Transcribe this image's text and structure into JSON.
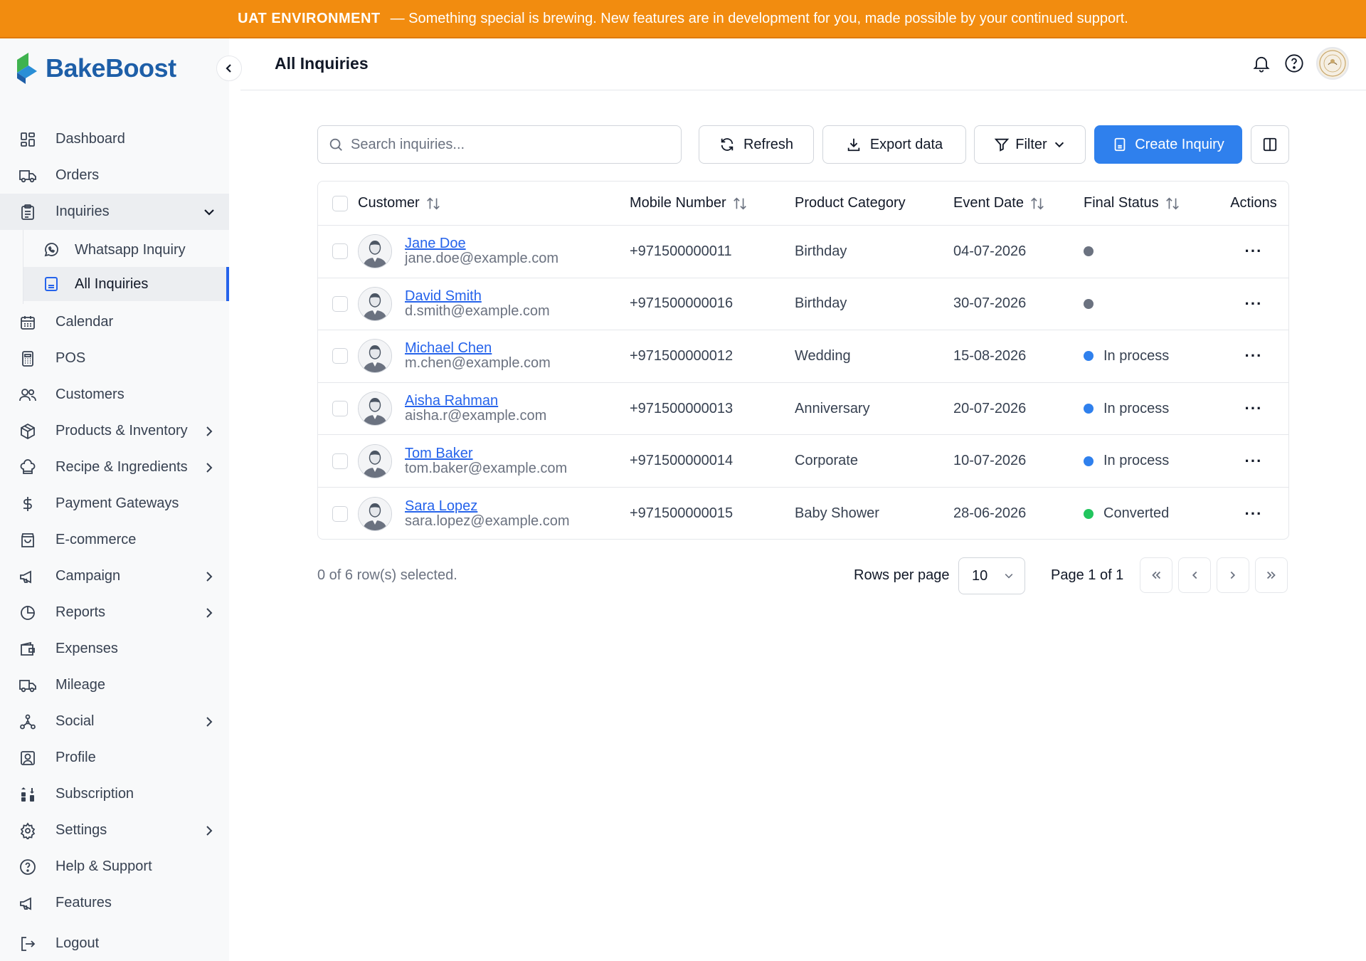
{
  "banner": {
    "env": "UAT ENVIRONMENT",
    "message": "— Something special is brewing. New features are in development for you, made possible by your continued support."
  },
  "brand": {
    "name": "BakeBoost",
    "color": "#1e5fa8"
  },
  "sidebar": {
    "items": [
      {
        "label": "Dashboard",
        "icon": "dashboard-icon"
      },
      {
        "label": "Orders",
        "icon": "truck-icon"
      },
      {
        "label": "Inquiries",
        "icon": "clipboard-icon",
        "expanded": true,
        "children": [
          {
            "label": "Whatsapp Inquiry",
            "icon": "whatsapp-icon"
          },
          {
            "label": "All Inquiries",
            "icon": "document-icon",
            "active": true
          }
        ]
      },
      {
        "label": "Calendar",
        "icon": "calendar-icon"
      },
      {
        "label": "POS",
        "icon": "calculator-icon"
      },
      {
        "label": "Customers",
        "icon": "users-icon"
      },
      {
        "label": "Products & Inventory",
        "icon": "box-icon",
        "has_children": true
      },
      {
        "label": "Recipe & Ingredients",
        "icon": "chef-hat-icon",
        "has_children": true
      },
      {
        "label": "Payment Gateways",
        "icon": "dollar-icon"
      },
      {
        "label": "E-commerce",
        "icon": "shopping-bag-icon"
      },
      {
        "label": "Campaign",
        "icon": "megaphone-icon",
        "has_children": true
      },
      {
        "label": "Reports",
        "icon": "pie-chart-icon",
        "has_children": true
      },
      {
        "label": "Expenses",
        "icon": "wallet-icon"
      },
      {
        "label": "Mileage",
        "icon": "truck-icon"
      },
      {
        "label": "Social",
        "icon": "share-icon",
        "has_children": true
      },
      {
        "label": "Profile",
        "icon": "profile-icon"
      },
      {
        "label": "Subscription",
        "icon": "subscription-icon"
      },
      {
        "label": "Settings",
        "icon": "gear-icon",
        "has_children": true
      },
      {
        "label": "Help & Support",
        "icon": "help-icon"
      },
      {
        "label": "Features",
        "icon": "megaphone-icon"
      },
      {
        "label": "Logout",
        "icon": "logout-icon"
      }
    ]
  },
  "header": {
    "title": "All Inquiries"
  },
  "toolbar": {
    "search_placeholder": "Search inquiries...",
    "refresh_label": "Refresh",
    "export_label": "Export data",
    "filter_label": "Filter",
    "create_label": "Create Inquiry"
  },
  "table": {
    "columns": {
      "customer": "Customer",
      "mobile": "Mobile Number",
      "product": "Product Category",
      "event_date": "Event Date",
      "status": "Final Status",
      "actions": "Actions"
    },
    "rows": [
      {
        "name": "Jane Doe",
        "email": "jane.doe@example.com",
        "mobile": "+971500000011",
        "product": "Birthday",
        "date": "04-07-2026",
        "status": "",
        "status_color": "#6b7280"
      },
      {
        "name": "David Smith",
        "email": "d.smith@example.com",
        "mobile": "+971500000016",
        "product": "Birthday",
        "date": "30-07-2026",
        "status": "",
        "status_color": "#6b7280"
      },
      {
        "name": "Michael Chen",
        "email": "m.chen@example.com",
        "mobile": "+971500000012",
        "product": "Wedding",
        "date": "15-08-2026",
        "status": "In process",
        "status_color": "#2f80ed"
      },
      {
        "name": "Aisha Rahman",
        "email": "aisha.r@example.com",
        "mobile": "+971500000013",
        "product": "Anniversary",
        "date": "20-07-2026",
        "status": "In process",
        "status_color": "#2f80ed"
      },
      {
        "name": "Tom Baker",
        "email": "tom.baker@example.com",
        "mobile": "+971500000014",
        "product": "Corporate",
        "date": "10-07-2026",
        "status": "In process",
        "status_color": "#2f80ed"
      },
      {
        "name": "Sara Lopez",
        "email": "sara.lopez@example.com",
        "mobile": "+971500000015",
        "product": "Baby Shower",
        "date": "28-06-2026",
        "status": "Converted",
        "status_color": "#22c55e"
      }
    ],
    "actions_glyph": "···"
  },
  "footer": {
    "selected_text": "0 of 6 row(s) selected.",
    "rows_per_page_label": "Rows per page",
    "rows_per_page_value": "10",
    "page_info": "Page 1 of 1"
  },
  "colors": {
    "accent": "#2f80ed",
    "banner": "#f28c0f",
    "active_bar": "#2563eb"
  }
}
